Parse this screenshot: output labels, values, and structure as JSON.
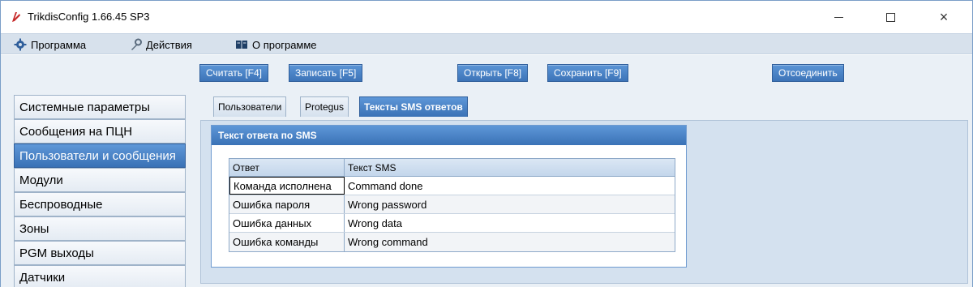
{
  "window": {
    "title": "TrikdisConfig 1.66.45   SP3",
    "controls": {
      "minimize": "minimize",
      "maximize": "maximize",
      "close": "×"
    }
  },
  "menu": {
    "program": "Программа",
    "actions": "Действия",
    "about": "О программе"
  },
  "toolbar": {
    "read": "Считать [F4]",
    "write": "Записать [F5]",
    "open": "Открыть [F8]",
    "save": "Сохранить [F9]",
    "disconnect": "Отсоединить"
  },
  "sidebar": {
    "items": [
      {
        "label": "Системные параметры",
        "active": false
      },
      {
        "label": "Сообщения на ПЦН",
        "active": false
      },
      {
        "label": "Пользователи и сообщения",
        "active": true
      },
      {
        "label": "Модули",
        "active": false
      },
      {
        "label": "Беспроводные",
        "active": false
      },
      {
        "label": "Зоны",
        "active": false
      },
      {
        "label": "PGM выходы",
        "active": false
      },
      {
        "label": "Датчики",
        "active": false
      }
    ]
  },
  "tabs": {
    "users": "Пользователи",
    "protegus": "Protegus",
    "sms": "Тексты SMS ответов"
  },
  "group": {
    "title": "Текст ответа по SMS"
  },
  "sms_table": {
    "headers": [
      "Ответ",
      "Текст SMS"
    ],
    "rows": [
      [
        "Команда исполнена",
        "Command done"
      ],
      [
        "Ошибка пароля",
        "Wrong password"
      ],
      [
        "Ошибка данных",
        "Wrong data"
      ],
      [
        "Ошибка команды",
        "Wrong command"
      ]
    ]
  },
  "colors": {
    "accent": "#3a72b6",
    "menubar": "#d7e1ec",
    "panel": "#d4e1ef"
  }
}
